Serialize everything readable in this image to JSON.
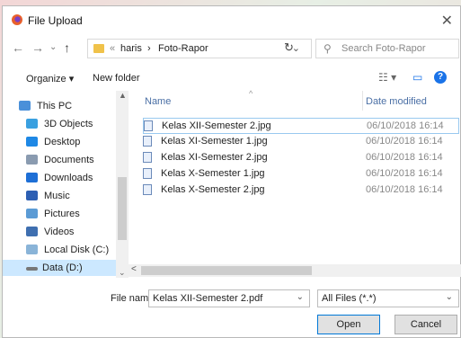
{
  "window": {
    "title": "File Upload",
    "close_glyph": "✕"
  },
  "nav": {
    "back_glyph": "←",
    "forward_glyph": "→",
    "recent_glyph": "⌄",
    "up_glyph": "↑",
    "breadcrumb": [
      "«",
      "haris",
      "›",
      "Foto-Rapor"
    ],
    "address_dropdown_glyph": "⌄",
    "refresh_glyph": "↻",
    "search_placeholder": "Search Foto-Rapor",
    "search_icon": "⚲"
  },
  "command_bar": {
    "organize_label": "Organize ▾",
    "new_folder_label": "New folder",
    "view_icon": "☷ ▾",
    "pane_icon": "▭",
    "help_label": "?"
  },
  "sidebar": {
    "items": [
      {
        "label": "This PC",
        "icon": "computer-icon",
        "color": "#4a90d9"
      },
      {
        "label": "3D Objects",
        "icon": "cube-icon",
        "color": "#3aa0e0"
      },
      {
        "label": "Desktop",
        "icon": "desktop-icon",
        "color": "#1e88e5"
      },
      {
        "label": "Documents",
        "icon": "document-icon",
        "color": "#8a9bb0"
      },
      {
        "label": "Downloads",
        "icon": "download-icon",
        "color": "#1e6fd6"
      },
      {
        "label": "Music",
        "icon": "music-icon",
        "color": "#2d5fb3"
      },
      {
        "label": "Pictures",
        "icon": "pictures-icon",
        "color": "#5b9bd5"
      },
      {
        "label": "Videos",
        "icon": "videos-icon",
        "color": "#3f6fb0"
      },
      {
        "label": "Local Disk (C:)",
        "icon": "drive-icon",
        "color": "#8ab4d8"
      },
      {
        "label": "Data (D:)",
        "icon": "drive-icon",
        "color": "#777777"
      }
    ]
  },
  "file_list": {
    "columns": {
      "name": "Name",
      "date": "Date modified",
      "sort_glyph": "^"
    },
    "rows": [
      {
        "name": "Kelas XII-Semester 2.jpg",
        "date": "06/10/2018 16:14"
      },
      {
        "name": "Kelas XI-Semester 1.jpg",
        "date": "06/10/2018 16:14"
      },
      {
        "name": "Kelas XI-Semester 2.jpg",
        "date": "06/10/2018 16:14"
      },
      {
        "name": "Kelas X-Semester 1.jpg",
        "date": "06/10/2018 16:14"
      },
      {
        "name": "Kelas X-Semester 2.jpg",
        "date": "06/10/2018 16:14"
      }
    ]
  },
  "bottom": {
    "file_name_label": "File name:",
    "file_name_value": "Kelas XII-Semester 2.pdf",
    "file_type_value": "All Files (*.*)",
    "dropdown_glyph": "⌄",
    "open_label": "Open",
    "cancel_label": "Cancel"
  },
  "scroll": {
    "up": "▲",
    "down": "⌄",
    "left": "<"
  },
  "colors": {
    "accent": "#0078d7",
    "selection": "#cce8ff",
    "help": "#1a73e8"
  }
}
